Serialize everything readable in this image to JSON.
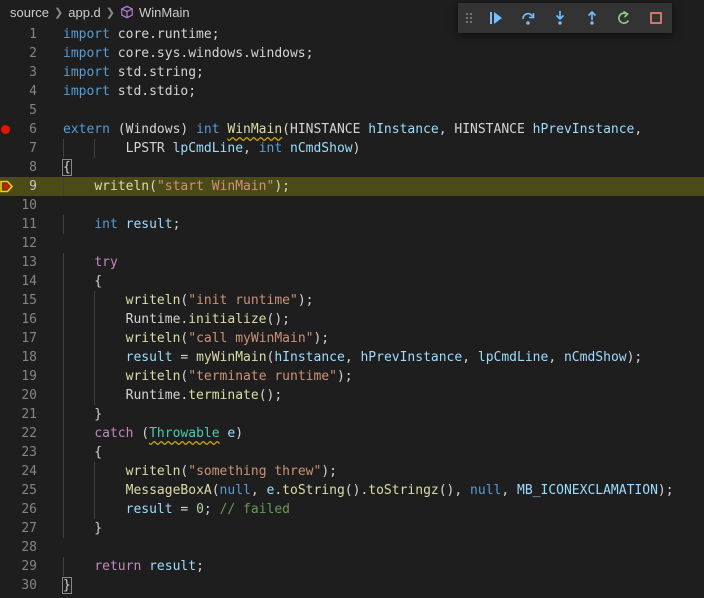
{
  "breadcrumb": {
    "folder": "source",
    "file": "app.d",
    "symbol": "WinMain"
  },
  "colors": {
    "keyword": "#569cd6",
    "control": "#c586c0",
    "string": "#ce9178",
    "function": "#dcdcaa",
    "type": "#4ec9b0",
    "variable": "#9cdcfe",
    "number": "#b5cea8",
    "comment": "#6a9955",
    "breakpoint": "#e51400",
    "current_line": "#4b4b18"
  },
  "debug_toolbar": {
    "buttons": [
      {
        "name": "continue",
        "icon": "continue-icon"
      },
      {
        "name": "step-over",
        "icon": "step-over-icon"
      },
      {
        "name": "step-into",
        "icon": "step-into-icon"
      },
      {
        "name": "step-out",
        "icon": "step-out-icon"
      },
      {
        "name": "restart",
        "icon": "restart-icon"
      },
      {
        "name": "stop",
        "icon": "stop-icon"
      }
    ]
  },
  "editor": {
    "breakpoint_line": 6,
    "current_line": 9,
    "lines": [
      {
        "n": "1",
        "tokens": [
          [
            "kw",
            "import"
          ],
          [
            "p",
            " core.runtime;"
          ]
        ]
      },
      {
        "n": "2",
        "tokens": [
          [
            "kw",
            "import"
          ],
          [
            "p",
            " core.sys.windows.windows;"
          ]
        ]
      },
      {
        "n": "3",
        "tokens": [
          [
            "kw",
            "import"
          ],
          [
            "p",
            " std.string;"
          ]
        ]
      },
      {
        "n": "4",
        "tokens": [
          [
            "kw",
            "import"
          ],
          [
            "p",
            " std.stdio;"
          ]
        ]
      },
      {
        "n": "5",
        "tokens": []
      },
      {
        "n": "6",
        "tokens": [
          [
            "kw",
            "extern"
          ],
          [
            "p",
            " (Windows) "
          ],
          [
            "kw",
            "int"
          ],
          [
            "p",
            " "
          ],
          [
            "fn sq",
            "WinMain"
          ],
          [
            "p",
            "(HINSTANCE "
          ],
          [
            "vr",
            "hInstance"
          ],
          [
            "p",
            ", HINSTANCE "
          ],
          [
            "vr",
            "hPrevInstance"
          ],
          [
            "p",
            ","
          ]
        ]
      },
      {
        "n": "7",
        "tokens": [
          [
            "p",
            "        LPSTR "
          ],
          [
            "vr",
            "lpCmdLine"
          ],
          [
            "p",
            ", "
          ],
          [
            "kw",
            "int"
          ],
          [
            "p",
            " "
          ],
          [
            "vr",
            "nCmdShow"
          ],
          [
            "p",
            ")"
          ]
        ]
      },
      {
        "n": "8",
        "tokens": [
          [
            "bm",
            "{"
          ]
        ]
      },
      {
        "n": "9",
        "tokens": [
          [
            "p",
            "    "
          ],
          [
            "fn",
            "writeln"
          ],
          [
            "p",
            "("
          ],
          [
            "str",
            "\"start WinMain\""
          ],
          [
            "p",
            ");"
          ]
        ]
      },
      {
        "n": "10",
        "tokens": []
      },
      {
        "n": "11",
        "tokens": [
          [
            "p",
            "    "
          ],
          [
            "kw",
            "int"
          ],
          [
            "p",
            " "
          ],
          [
            "vr",
            "result"
          ],
          [
            "p",
            ";"
          ]
        ]
      },
      {
        "n": "12",
        "tokens": []
      },
      {
        "n": "13",
        "tokens": [
          [
            "p",
            "    "
          ],
          [
            "ctl",
            "try"
          ]
        ]
      },
      {
        "n": "14",
        "tokens": [
          [
            "p",
            "    {"
          ]
        ]
      },
      {
        "n": "15",
        "tokens": [
          [
            "p",
            "        "
          ],
          [
            "fn",
            "writeln"
          ],
          [
            "p",
            "("
          ],
          [
            "str",
            "\"init runtime\""
          ],
          [
            "p",
            ");"
          ]
        ]
      },
      {
        "n": "16",
        "tokens": [
          [
            "p",
            "        Runtime."
          ],
          [
            "fn",
            "initialize"
          ],
          [
            "p",
            "();"
          ]
        ]
      },
      {
        "n": "17",
        "tokens": [
          [
            "p",
            "        "
          ],
          [
            "fn",
            "writeln"
          ],
          [
            "p",
            "("
          ],
          [
            "str",
            "\"call myWinMain\""
          ],
          [
            "p",
            ");"
          ]
        ]
      },
      {
        "n": "18",
        "tokens": [
          [
            "p",
            "        "
          ],
          [
            "vr",
            "result"
          ],
          [
            "p",
            " = "
          ],
          [
            "fn",
            "myWinMain"
          ],
          [
            "p",
            "("
          ],
          [
            "vr",
            "hInstance"
          ],
          [
            "p",
            ", "
          ],
          [
            "vr",
            "hPrevInstance"
          ],
          [
            "p",
            ", "
          ],
          [
            "vr",
            "lpCmdLine"
          ],
          [
            "p",
            ", "
          ],
          [
            "vr",
            "nCmdShow"
          ],
          [
            "p",
            ");"
          ]
        ]
      },
      {
        "n": "19",
        "tokens": [
          [
            "p",
            "        "
          ],
          [
            "fn",
            "writeln"
          ],
          [
            "p",
            "("
          ],
          [
            "str",
            "\"terminate runtime\""
          ],
          [
            "p",
            ");"
          ]
        ]
      },
      {
        "n": "20",
        "tokens": [
          [
            "p",
            "        Runtime."
          ],
          [
            "fn",
            "terminate"
          ],
          [
            "p",
            "();"
          ]
        ]
      },
      {
        "n": "21",
        "tokens": [
          [
            "p",
            "    }"
          ]
        ]
      },
      {
        "n": "22",
        "tokens": [
          [
            "p",
            "    "
          ],
          [
            "ctl",
            "catch"
          ],
          [
            "p",
            " ("
          ],
          [
            "ty sq",
            "Throwable"
          ],
          [
            "p",
            " "
          ],
          [
            "vr",
            "e"
          ],
          [
            "p",
            ")"
          ]
        ]
      },
      {
        "n": "23",
        "tokens": [
          [
            "p",
            "    {"
          ]
        ]
      },
      {
        "n": "24",
        "tokens": [
          [
            "p",
            "        "
          ],
          [
            "fn",
            "writeln"
          ],
          [
            "p",
            "("
          ],
          [
            "str",
            "\"something threw\""
          ],
          [
            "p",
            ");"
          ]
        ]
      },
      {
        "n": "25",
        "tokens": [
          [
            "p",
            "        "
          ],
          [
            "fn",
            "MessageBoxA"
          ],
          [
            "p",
            "("
          ],
          [
            "kw",
            "null"
          ],
          [
            "p",
            ", "
          ],
          [
            "vr",
            "e"
          ],
          [
            "p",
            "."
          ],
          [
            "fn",
            "toString"
          ],
          [
            "p",
            "()."
          ],
          [
            "fn",
            "toStringz"
          ],
          [
            "p",
            "(), "
          ],
          [
            "kw",
            "null"
          ],
          [
            "p",
            ", "
          ],
          [
            "vr",
            "MB_ICONEXCLAMATION"
          ],
          [
            "p",
            ");"
          ]
        ]
      },
      {
        "n": "26",
        "tokens": [
          [
            "p",
            "        "
          ],
          [
            "vr",
            "result"
          ],
          [
            "p",
            " = "
          ],
          [
            "num",
            "0"
          ],
          [
            "p",
            "; "
          ],
          [
            "cm",
            "// failed"
          ]
        ]
      },
      {
        "n": "27",
        "tokens": [
          [
            "p",
            "    }"
          ]
        ]
      },
      {
        "n": "28",
        "tokens": []
      },
      {
        "n": "29",
        "tokens": [
          [
            "p",
            "    "
          ],
          [
            "ctl",
            "return"
          ],
          [
            "p",
            " "
          ],
          [
            "vr",
            "result"
          ],
          [
            "p",
            ";"
          ]
        ]
      },
      {
        "n": "30",
        "tokens": [
          [
            "bm",
            "}"
          ]
        ]
      }
    ]
  }
}
